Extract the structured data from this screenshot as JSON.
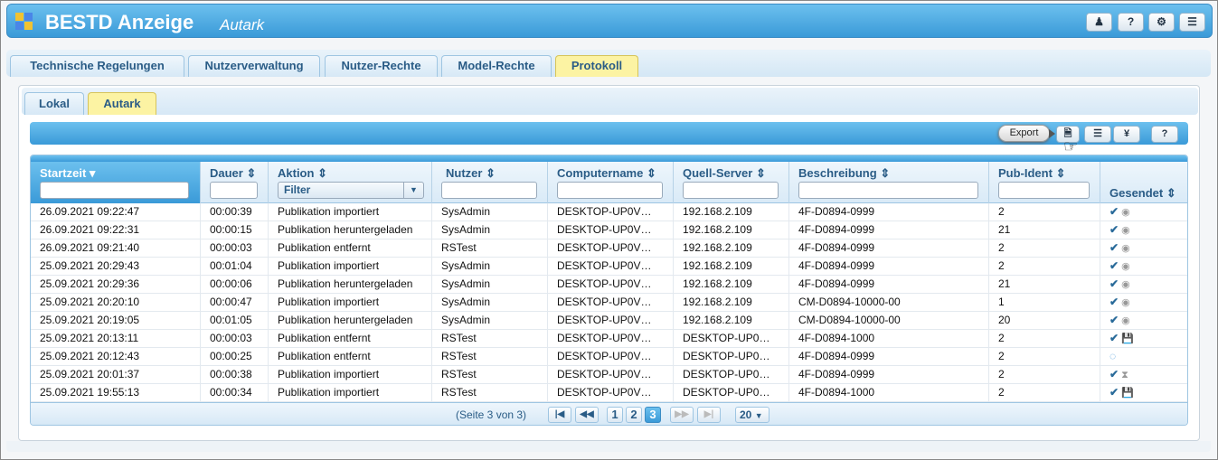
{
  "app": {
    "title": "BESTD Anzeige",
    "subtitle": "Autark"
  },
  "header_buttons": [
    "user-icon",
    "help-icon",
    "gear-icon",
    "menu-icon"
  ],
  "main_tabs": [
    {
      "label": "Technische Regelungen",
      "active": false
    },
    {
      "label": "Nutzerverwaltung",
      "active": false
    },
    {
      "label": "Nutzer-Rechte",
      "active": false
    },
    {
      "label": "Model-Rechte",
      "active": false
    },
    {
      "label": "Protokoll",
      "active": true
    }
  ],
  "sub_tabs": [
    {
      "label": "Lokal",
      "active": false
    },
    {
      "label": "Autark",
      "active": true
    }
  ],
  "toolbar": {
    "export_tooltip": "Export",
    "help_label": "?"
  },
  "columns": {
    "startzeit": "Startzeit",
    "dauer": "Dauer",
    "aktion": "Aktion",
    "nutzer": "Nutzer",
    "computername": "Computername",
    "quell_server": "Quell-Server",
    "beschreibung": "Beschreibung",
    "pub_ident": "Pub-Ident",
    "gesendet": "Gesendet"
  },
  "aktion_filter": "Filter",
  "rows": [
    {
      "startzeit": "26.09.2021 09:22:47",
      "dauer": "00:00:39",
      "aktion": "Publikation importiert",
      "nutzer": "SysAdmin",
      "computer": "DESKTOP-UP0V…",
      "server": "192.168.2.109",
      "beschreibung": "4F-D0894-0999",
      "pub": "2",
      "status": "check-globe"
    },
    {
      "startzeit": "26.09.2021 09:22:31",
      "dauer": "00:00:15",
      "aktion": "Publikation heruntergeladen",
      "nutzer": "SysAdmin",
      "computer": "DESKTOP-UP0V…",
      "server": "192.168.2.109",
      "beschreibung": "4F-D0894-0999",
      "pub": "21",
      "status": "check-globe"
    },
    {
      "startzeit": "26.09.2021 09:21:40",
      "dauer": "00:00:03",
      "aktion": "Publikation entfernt",
      "nutzer": "RSTest",
      "computer": "DESKTOP-UP0V…",
      "server": "192.168.2.109",
      "beschreibung": "4F-D0894-0999",
      "pub": "2",
      "status": "check-globe"
    },
    {
      "startzeit": "25.09.2021 20:29:43",
      "dauer": "00:01:04",
      "aktion": "Publikation importiert",
      "nutzer": "SysAdmin",
      "computer": "DESKTOP-UP0V…",
      "server": "192.168.2.109",
      "beschreibung": "4F-D0894-0999",
      "pub": "2",
      "status": "check-globe"
    },
    {
      "startzeit": "25.09.2021 20:29:36",
      "dauer": "00:00:06",
      "aktion": "Publikation heruntergeladen",
      "nutzer": "SysAdmin",
      "computer": "DESKTOP-UP0V…",
      "server": "192.168.2.109",
      "beschreibung": "4F-D0894-0999",
      "pub": "21",
      "status": "check-globe"
    },
    {
      "startzeit": "25.09.2021 20:20:10",
      "dauer": "00:00:47",
      "aktion": "Publikation importiert",
      "nutzer": "SysAdmin",
      "computer": "DESKTOP-UP0V…",
      "server": "192.168.2.109",
      "beschreibung": "CM-D0894-10000-00",
      "pub": "1",
      "status": "check-globe"
    },
    {
      "startzeit": "25.09.2021 20:19:05",
      "dauer": "00:01:05",
      "aktion": "Publikation heruntergeladen",
      "nutzer": "SysAdmin",
      "computer": "DESKTOP-UP0V…",
      "server": "192.168.2.109",
      "beschreibung": "CM-D0894-10000-00",
      "pub": "20",
      "status": "check-globe"
    },
    {
      "startzeit": "25.09.2021 20:13:11",
      "dauer": "00:00:03",
      "aktion": "Publikation entfernt",
      "nutzer": "RSTest",
      "computer": "DESKTOP-UP0V…",
      "server": "DESKTOP-UP0…",
      "beschreibung": "4F-D0894-1000",
      "pub": "2",
      "status": "check-save"
    },
    {
      "startzeit": "25.09.2021 20:12:43",
      "dauer": "00:00:25",
      "aktion": "Publikation entfernt",
      "nutzer": "RSTest",
      "computer": "DESKTOP-UP0V…",
      "server": "DESKTOP-UP0…",
      "beschreibung": "4F-D0894-0999",
      "pub": "2",
      "status": "spinner"
    },
    {
      "startzeit": "25.09.2021 20:01:37",
      "dauer": "00:00:38",
      "aktion": "Publikation importiert",
      "nutzer": "RSTest",
      "computer": "DESKTOP-UP0V…",
      "server": "DESKTOP-UP0…",
      "beschreibung": "4F-D0894-0999",
      "pub": "2",
      "status": "check-broadcast"
    },
    {
      "startzeit": "25.09.2021 19:55:13",
      "dauer": "00:00:34",
      "aktion": "Publikation importiert",
      "nutzer": "RSTest",
      "computer": "DESKTOP-UP0V…",
      "server": "DESKTOP-UP0…",
      "beschreibung": "4F-D0894-1000",
      "pub": "2",
      "status": "check-save"
    }
  ],
  "pager": {
    "info": "(Seite 3 von 3)",
    "pages": [
      "1",
      "2",
      "3"
    ],
    "current": "3",
    "page_size": "20"
  }
}
